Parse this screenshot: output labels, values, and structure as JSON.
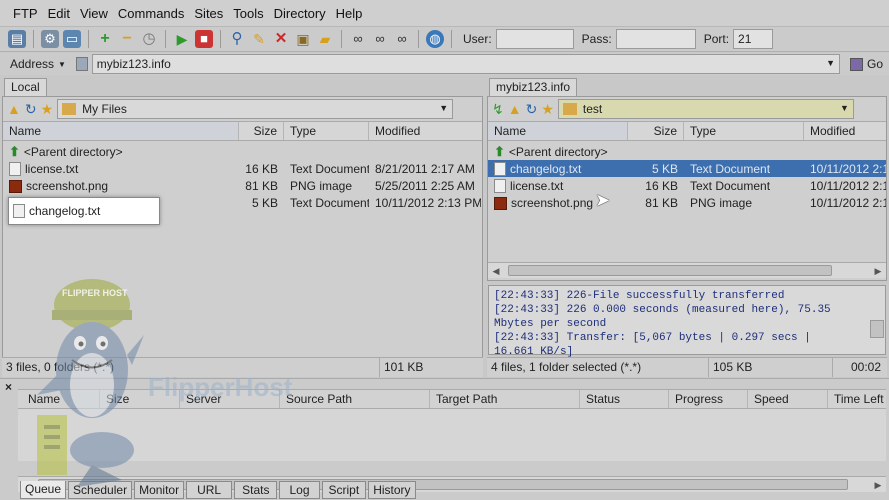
{
  "menu": [
    "FTP",
    "Edit",
    "View",
    "Commands",
    "Sites",
    "Tools",
    "Directory",
    "Help"
  ],
  "toolbar": {
    "user_label": "User:",
    "user_value": "",
    "pass_label": "Pass:",
    "pass_value": "",
    "port_label": "Port:",
    "port_value": "21"
  },
  "address": {
    "label": "Address",
    "value": "mybiz123.info",
    "go_label": "Go"
  },
  "local": {
    "tab": "Local",
    "path": "My Files",
    "columns": [
      "Name",
      "Size",
      "Type",
      "Modified"
    ],
    "parent": "<Parent directory>",
    "files": [
      {
        "name": "license.txt",
        "size": "16 KB",
        "type": "Text Document",
        "modified": "8/21/2011 2:17 AM",
        "icon": "text-file-icon"
      },
      {
        "name": "screenshot.png",
        "size": "81 KB",
        "type": "PNG image",
        "modified": "5/25/2011 2:25 AM",
        "icon": "png-file-icon"
      },
      {
        "name": "changelog.txt",
        "size": "5 KB",
        "type": "Text Document",
        "modified": "10/11/2012 2:13 PM",
        "icon": "text-file-icon"
      }
    ],
    "status_left": "3 files, 0 folders (*.*)",
    "status_right": "101 KB"
  },
  "remote": {
    "tab": "mybiz123.info",
    "path": "test",
    "columns": [
      "Name",
      "Size",
      "Type",
      "Modified"
    ],
    "parent": "<Parent directory>",
    "files": [
      {
        "name": "changelog.txt",
        "size": "5 KB",
        "type": "Text Document",
        "modified": "10/11/2012 2:1",
        "icon": "text-file-icon"
      },
      {
        "name": "license.txt",
        "size": "16 KB",
        "type": "Text Document",
        "modified": "10/11/2012 2:1",
        "icon": "text-file-icon"
      },
      {
        "name": "screenshot.png",
        "size": "81 KB",
        "type": "PNG image",
        "modified": "10/11/2012 2:1",
        "icon": "png-file-icon"
      }
    ],
    "status_left": "4 files, 1 folder selected (*.*)",
    "status_mid": "105 KB",
    "status_right": "00:02"
  },
  "log": [
    "[22:43:33] 226-File successfully transferred",
    "[22:43:33] 226 0.000 seconds (measured here), 75.35",
    "Mbytes per second",
    "[22:43:33] Transfer: [5,067 bytes | 0.297 secs |",
    "16.661 KB/s]"
  ],
  "queue": {
    "columns": [
      "Name",
      "Size",
      "Server",
      "Source Path",
      "Target Path",
      "Status",
      "Progress",
      "Speed",
      "Time Left"
    ],
    "tabs": [
      "Queue",
      "Scheduler",
      "Monitor",
      "URL",
      "Stats",
      "Log",
      "Script",
      "History"
    ],
    "close_glyph": "×"
  },
  "watermark": {
    "brand": "FlipperHost",
    "badge": "FLIPPER HOST"
  },
  "colors": {
    "accent": "#3d6fae",
    "log_text": "#1e2e7a",
    "path_folder_bg": "#d9d9b0"
  }
}
